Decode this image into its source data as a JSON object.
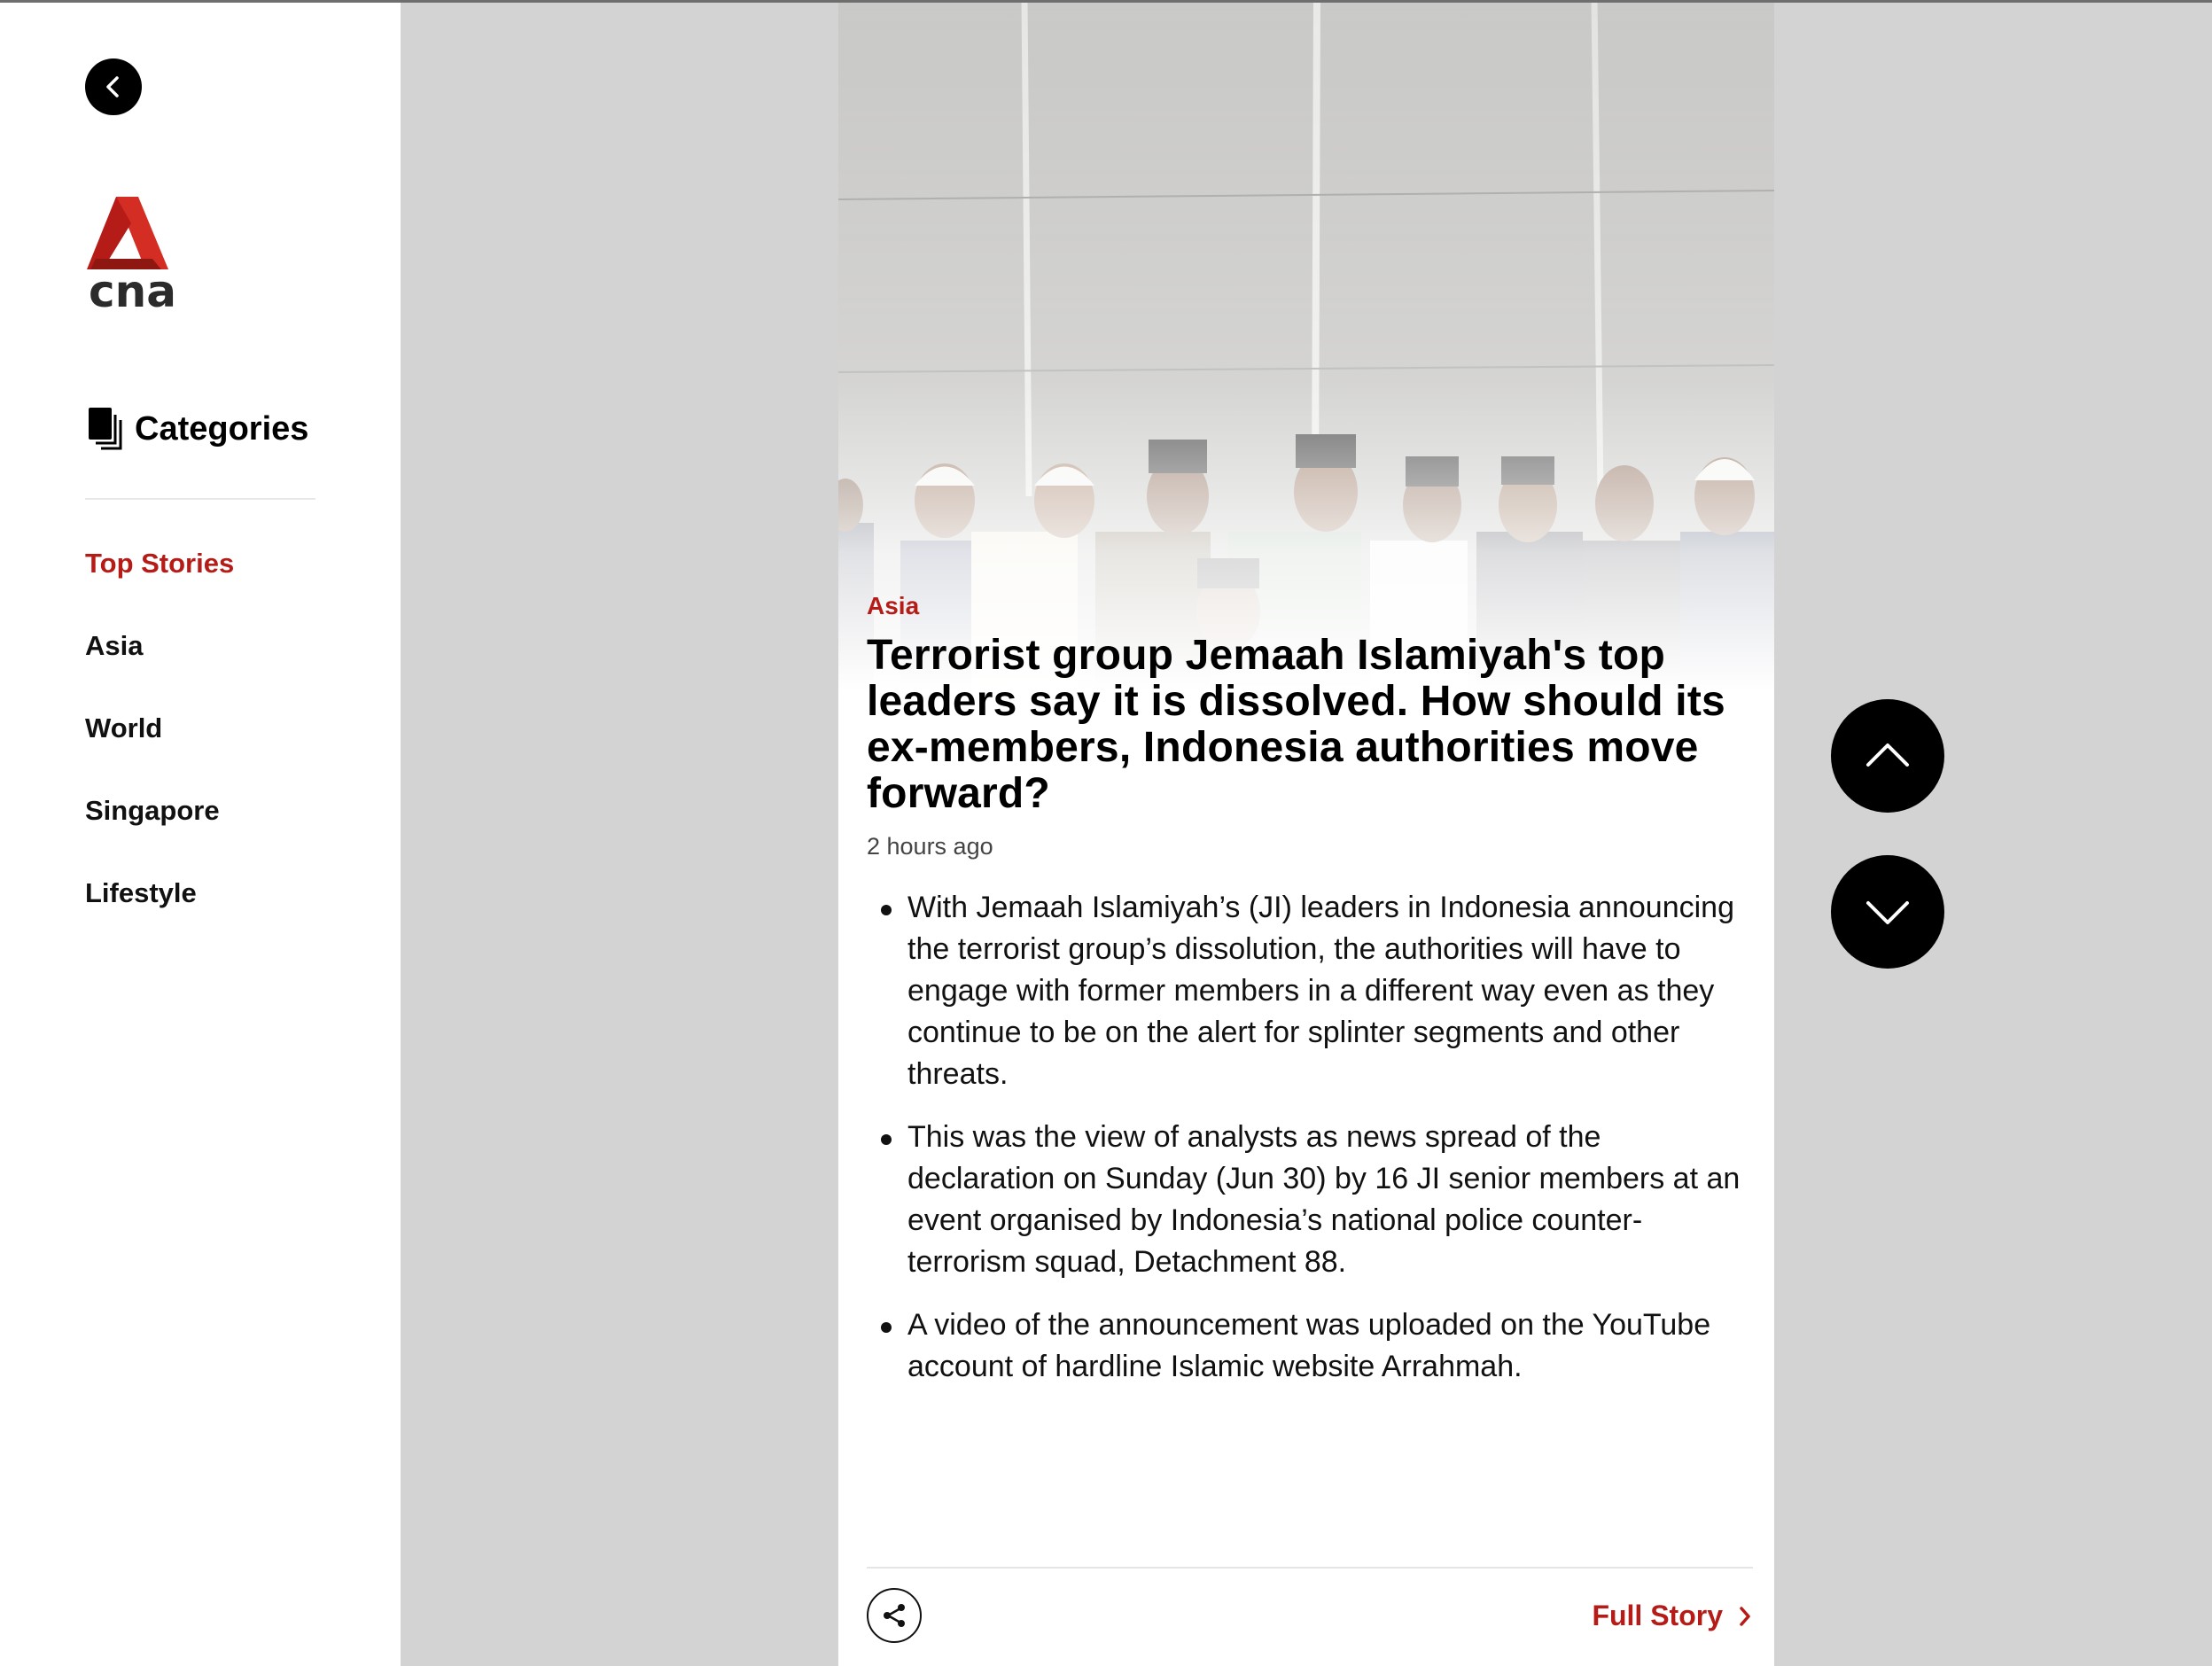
{
  "brand": {
    "logo_text": "cna",
    "accent_color": "#b51c17"
  },
  "sidebar": {
    "back_icon": "chevron-left-icon",
    "categories_icon": "documents-icon",
    "categories_title": "Categories",
    "items": [
      {
        "label": "Top Stories",
        "active": true
      },
      {
        "label": "Asia",
        "active": false
      },
      {
        "label": "World",
        "active": false
      },
      {
        "label": "Singapore",
        "active": false
      },
      {
        "label": "Lifestyle",
        "active": false
      }
    ]
  },
  "article": {
    "category": "Asia",
    "headline": "Terrorist group Jemaah Islamiyah's top leaders say it is dissolved. How should its ex-members, Indonesia authorities move forward?",
    "time": "2 hours ago",
    "bullets": [
      "With Jemaah Islamiyah’s (JI) leaders in Indonesia announcing the terrorist group’s dissolution, the authorities will have to engage with former members in a different way even as they continue to be on the alert for splinter segments and other threats.",
      "This was the view of analysts as news spread of the declaration on Sunday (Jun 30) by 16 JI senior members at an event organised by Indonesia’s national police counter-terrorism squad, Detachment 88.",
      "A video of the announcement was uploaded on the YouTube account of hardline Islamic website Arrahmah."
    ],
    "share_icon": "share-icon",
    "full_story_label": "Full Story",
    "full_story_icon": "chevron-right-icon"
  },
  "navigation": {
    "prev_icon": "chevron-up-icon",
    "next_icon": "chevron-down-icon"
  }
}
